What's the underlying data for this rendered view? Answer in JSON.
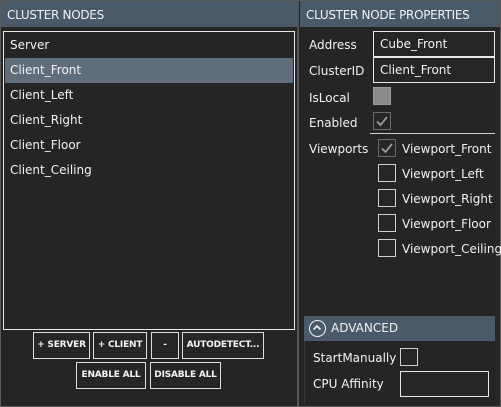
{
  "left_panel": {
    "title": "CLUSTER NODES",
    "nodes": [
      "Server",
      "Client_Front",
      "Client_Left",
      "Client_Right",
      "Client_Floor",
      "Client_Ceiling"
    ],
    "selected_node": "Client_Front"
  },
  "buttons": {
    "add_server": "+ SERVER",
    "add_client": "+ CLIENT",
    "remove": "-",
    "autodetect": "AUTODETECT...",
    "enable_all": "ENABLE ALL",
    "disable_all": "DISABLE ALL"
  },
  "properties": {
    "title": "CLUSTER NODE PROPERTIES",
    "address_label": "Address",
    "address_value": "Cube_Front",
    "clusterid_label": "ClusterID",
    "clusterid_value": "Client_Front",
    "islocal_label": "IsLocal",
    "islocal_checked": false,
    "enabled_label": "Enabled",
    "enabled_checked": true,
    "viewports_label": "Viewports",
    "viewports": [
      {
        "label": "Viewport_Front",
        "checked": true
      },
      {
        "label": "Viewport_Left",
        "checked": false
      },
      {
        "label": "Viewport_Right",
        "checked": false
      },
      {
        "label": "Viewport_Floor",
        "checked": false
      },
      {
        "label": "Viewport_Ceiling",
        "checked": false
      }
    ]
  },
  "advanced": {
    "title": "ADVANCED",
    "icon": "chevron-up-circle-icon",
    "start_manually_label": "StartManually",
    "start_manually_checked": false,
    "cpu_affinity_label": "CPU Affinity",
    "cpu_affinity_value": ""
  },
  "colors": {
    "background": "#252525",
    "header": "#4b5a68",
    "selection": "#606d7a",
    "text": "#f2f2f2"
  }
}
